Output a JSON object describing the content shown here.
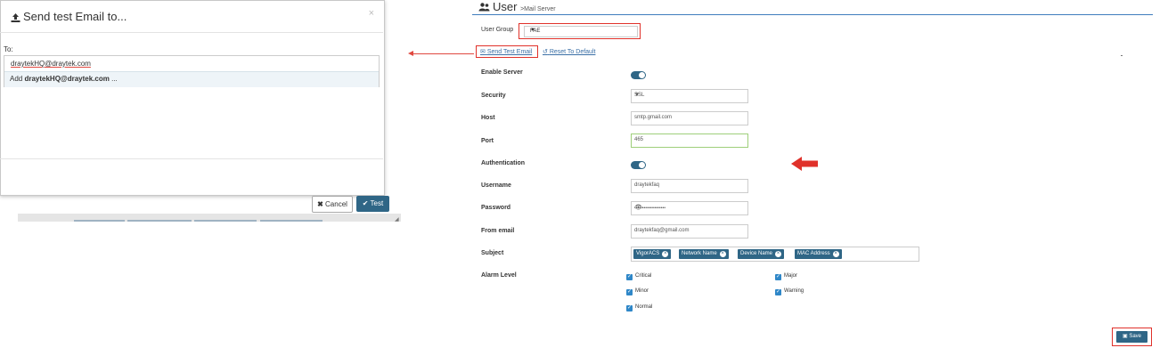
{
  "dialog": {
    "title": "Send test Email to...",
    "close": "×",
    "to_label": "To:",
    "recipient": "draytekHQ@draytek.com",
    "suggest_prefix": "Add ",
    "suggest_email": "draytekHQ@draytek.com",
    "suggest_suffix": " ...",
    "cancel_label": "Cancel",
    "test_label": "Test"
  },
  "page": {
    "title": "User",
    "breadcrumb": ">Mail Server"
  },
  "form": {
    "user_group_label": "User Group",
    "user_group_value": "FAE",
    "send_test_email": "Send Test Email",
    "reset_to_default": "Reset To Default",
    "enable_server_label": "Enable Server",
    "enable_server": true,
    "security_label": "Security",
    "security_value": "SSL",
    "host_label": "Host",
    "host_value": "smtp.gmail.com",
    "port_label": "Port",
    "port_value": "465",
    "authentication_label": "Authentication",
    "authentication": true,
    "username_label": "Username",
    "username_value": "draytekfaq",
    "password_label": "Password",
    "password_value": "••••••••••••••••••••",
    "from_email_label": "From email",
    "from_email_value": "draytekfaq@gmail.com",
    "subject_label": "Subject",
    "subject_tags": [
      "VigorACS",
      "Network Name",
      "Device Name",
      "MAC Address"
    ],
    "alarm_level_label": "Alarm Level",
    "alarm_levels": [
      {
        "label": "Critical",
        "checked": true
      },
      {
        "label": "Major",
        "checked": true
      },
      {
        "label": "Minor",
        "checked": true
      },
      {
        "label": "Warning",
        "checked": true
      },
      {
        "label": "Normal",
        "checked": true
      }
    ],
    "save_label": "Save"
  },
  "colors": {
    "accent": "#2f6686",
    "highlight": "#e0312a",
    "link": "#3a6fa6"
  }
}
